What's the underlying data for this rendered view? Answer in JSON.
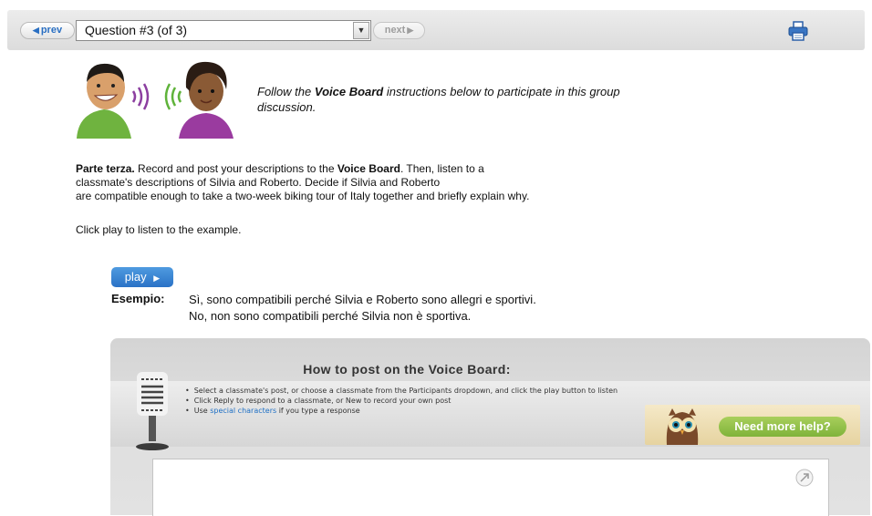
{
  "nav": {
    "prev_label": "prev",
    "question_label": "Question #3 (of 3)",
    "next_label": "next"
  },
  "intro": {
    "text_before": "Follow the ",
    "text_bold": "Voice Board",
    "text_after": " instructions below to participate in this group discussion."
  },
  "instructions": {
    "bold_lead": "Parte terza.",
    "part1": " Record and post your descriptions to the ",
    "bold_vb": "Voice Board",
    "part2": ". Then, listen to a",
    "line2": "classmate's descriptions of Silvia and Roberto. Decide if Silvia and Roberto",
    "line3": "are compatible enough to take a two-week biking tour of Italy together and briefly explain why."
  },
  "click_play": "Click play to listen to the example.",
  "play_label": "play",
  "esempio": {
    "label": "Esempio:",
    "line1": "Sì, sono compatibili perché Silvia e Roberto sono allegri e sportivi.",
    "line2": "No, non sono compatibili perché Silvia non è sportiva."
  },
  "voice_board": {
    "title": "How to post on the Voice Board:",
    "step1": "Select a classmate's post, or choose a classmate from the Participants dropdown, and click the play button to listen",
    "step2": "Click Reply to respond to a classmate, or New to record your own post",
    "step3_before": "Use ",
    "step3_link": "special characters",
    "step3_after": " if you type a response",
    "help_label": "Need more help?"
  },
  "colors": {
    "accent_blue": "#2a72c6",
    "help_green": "#7fb33a",
    "link_blue": "#1e6fc4"
  },
  "icons": [
    "prev-arrow-icon",
    "dropdown-arrow-icon",
    "next-arrow-icon",
    "printer-icon",
    "play-arrow-icon",
    "microphone-icon",
    "owl-icon",
    "expand-icon"
  ]
}
